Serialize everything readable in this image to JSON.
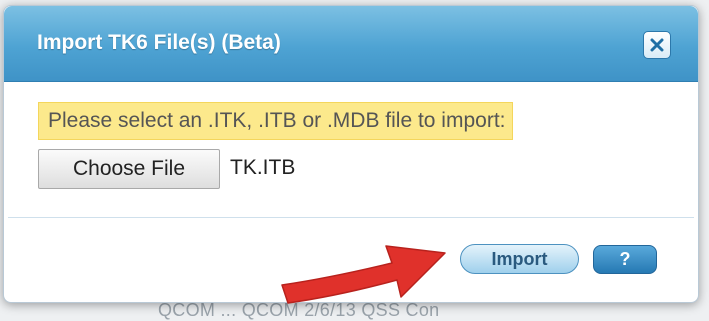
{
  "background": {
    "partial_text": "QCOM ... QCOM 2/6/13 QSS Con"
  },
  "dialog": {
    "title": "Import TK6 File(s) (Beta)",
    "close_icon": "close-icon",
    "notice": "Please select an .ITK, .ITB or .MDB file to import:",
    "file_input": {
      "button_label": "Choose File",
      "selected_file": "TK.ITB"
    },
    "buttons": {
      "import_label": "Import",
      "help_label": "?"
    }
  },
  "annotation": {
    "arrow_icon": "red-arrow-icon",
    "arrow_color": "#e0312b"
  },
  "colors": {
    "title_bar": "#4ea3d3",
    "notice_highlight": "#fce98c",
    "help_button": "#2679b3"
  }
}
